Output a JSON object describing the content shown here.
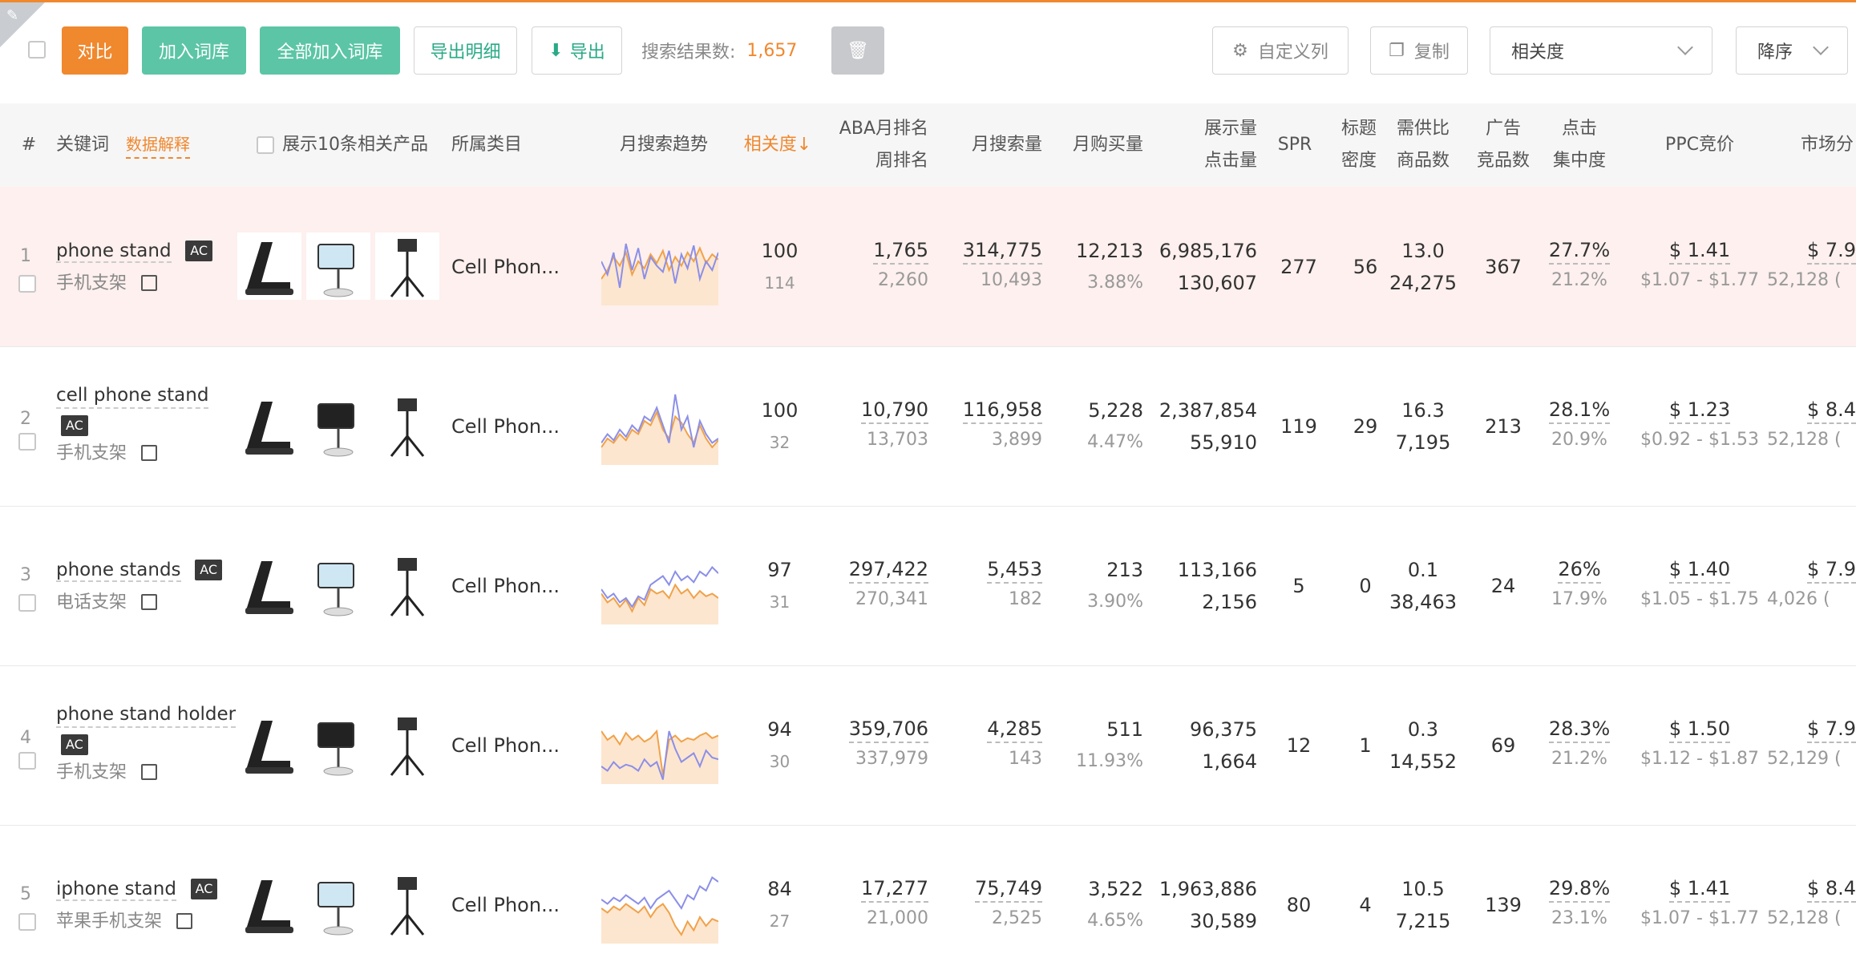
{
  "toolbar": {
    "compare": "对比",
    "add_lib": "加入词库",
    "add_all_lib": "全部加入词库",
    "export_detail": "导出明细",
    "export": "导出",
    "result_label": "搜索结果数:",
    "result_count": "1,657",
    "custom_cols": "自定义列",
    "copy": "复制",
    "sort_by": "相关度",
    "order": "降序"
  },
  "colors": {
    "accent": "#f0882e",
    "green": "#5cc5a5",
    "trend_orange": "#f0a24a",
    "trend_blue": "#8b8fe8"
  },
  "header": {
    "idx": "#",
    "keyword": "关键词",
    "data_explain": "数据解释",
    "show_products": "展示10条相关产品",
    "category": "所属类目",
    "trend": "月搜索趋势",
    "relevance": "相关度↓",
    "aba_month": "ABA月排名",
    "aba_week": "周排名",
    "monthly_search": "月搜索量",
    "monthly_buy": "月购买量",
    "impressions": "展示量",
    "clicks": "点击量",
    "spr": "SPR",
    "title_density_1": "标题",
    "title_density_2": "密度",
    "supply_1": "需供比",
    "supply_2": "商品数",
    "ad_1": "广告",
    "ad_2": "竞品数",
    "click_conc_1": "点击",
    "click_conc_2": "集中度",
    "ppc": "PPC竞价",
    "market": "市场分"
  },
  "rows": [
    {
      "idx": "1",
      "keyword": "phone stand",
      "ac": "AC",
      "cn": "手机支架",
      "category": "Cell Phon...",
      "rel": "100",
      "rel_sub": "114",
      "aba": "1,765",
      "aba_week": "2,260",
      "search": "314,775",
      "search_sub": "10,493",
      "buy": "12,213",
      "buy_rate": "3.88%",
      "impr": "6,985,176",
      "clicks": "130,607",
      "spr": "277",
      "title_density": "56",
      "supply": "13.0",
      "supply_sub": "24,275",
      "ad": "367",
      "conc": "27.7%",
      "conc_sub": "21.2%",
      "ppc": "$ 1.41",
      "ppc_range": "$1.07 - $1.77",
      "market": "$ 7.9",
      "market_sub": "52,128 (",
      "trend": {
        "orange": [
          30,
          40,
          55,
          45,
          60,
          35,
          50,
          42,
          58,
          48,
          62,
          40,
          55,
          45,
          60,
          50,
          65,
          48,
          58,
          52
        ],
        "blue": [
          50,
          35,
          60,
          20,
          70,
          40,
          65,
          30,
          55,
          45,
          38,
          62,
          25,
          58,
          42,
          68,
          30,
          50,
          40,
          60
        ]
      }
    },
    {
      "idx": "2",
      "keyword": "cell phone stand",
      "ac": "AC",
      "cn": "手机支架",
      "category": "Cell Phon...",
      "rel": "100",
      "rel_sub": "32",
      "aba": "10,790",
      "aba_week": "13,703",
      "search": "116,958",
      "search_sub": "3,899",
      "buy": "5,228",
      "buy_rate": "4.47%",
      "impr": "2,387,854",
      "clicks": "55,910",
      "spr": "119",
      "title_density": "29",
      "supply": "16.3",
      "supply_sub": "7,195",
      "ad": "213",
      "conc": "28.1%",
      "conc_sub": "20.9%",
      "ppc": "$ 1.23",
      "ppc_range": "$0.92 - $1.53",
      "market": "$ 8.4",
      "market_sub": "52,128 (",
      "trend": {
        "orange": [
          20,
          30,
          25,
          35,
          28,
          40,
          35,
          50,
          45,
          60,
          40,
          30,
          55,
          48,
          35,
          25,
          45,
          30,
          20,
          28
        ],
        "blue": [
          25,
          35,
          28,
          40,
          32,
          45,
          38,
          55,
          50,
          65,
          45,
          25,
          80,
          40,
          55,
          20,
          50,
          35,
          25,
          30
        ]
      }
    },
    {
      "idx": "3",
      "keyword": "phone stands",
      "ac": "AC",
      "cn": "电话支架",
      "category": "Cell Phon...",
      "rel": "97",
      "rel_sub": "31",
      "aba": "297,422",
      "aba_week": "270,341",
      "search": "5,453",
      "search_sub": "182",
      "buy": "213",
      "buy_rate": "3.90%",
      "impr": "113,166",
      "clicks": "2,156",
      "spr": "5",
      "title_density": "0",
      "supply": "0.1",
      "supply_sub": "38,463",
      "ad": "24",
      "conc": "26%",
      "conc_sub": "17.9%",
      "ppc": "$ 1.40",
      "ppc_range": "$1.05 - $1.75",
      "market": "$ 7.9",
      "market_sub": "4,026 (",
      "trend": {
        "orange": [
          35,
          25,
          30,
          20,
          28,
          15,
          30,
          22,
          40,
          35,
          38,
          30,
          45,
          35,
          40,
          30,
          38,
          32,
          35,
          30
        ],
        "blue": [
          40,
          30,
          35,
          25,
          30,
          20,
          32,
          28,
          45,
          50,
          55,
          45,
          60,
          50,
          55,
          48,
          60,
          55,
          65,
          58
        ]
      }
    },
    {
      "idx": "4",
      "keyword": "phone stand holder",
      "ac": "AC",
      "cn": "手机支架",
      "category": "Cell Phon...",
      "rel": "94",
      "rel_sub": "30",
      "aba": "359,706",
      "aba_week": "337,979",
      "search": "4,285",
      "search_sub": "143",
      "buy": "511",
      "buy_rate": "11.93%",
      "impr": "96,375",
      "clicks": "1,664",
      "spr": "12",
      "title_density": "1",
      "supply": "0.3",
      "supply_sub": "14,552",
      "ad": "69",
      "conc": "28.3%",
      "conc_sub": "21.2%",
      "ppc": "$ 1.50",
      "ppc_range": "$1.12 - $1.87",
      "market": "$ 7.9",
      "market_sub": "52,129 (",
      "trend": {
        "orange": [
          60,
          50,
          55,
          45,
          58,
          50,
          55,
          48,
          52,
          60,
          10,
          50,
          55,
          48,
          52,
          50,
          55,
          58,
          52,
          55
        ],
        "blue": [
          20,
          15,
          25,
          18,
          22,
          20,
          15,
          28,
          20,
          25,
          5,
          60,
          40,
          25,
          30,
          35,
          20,
          38,
          30,
          28
        ]
      }
    },
    {
      "idx": "5",
      "keyword": "iphone stand",
      "ac": "AC",
      "cn": "苹果手机支架",
      "category": "Cell Phon...",
      "rel": "84",
      "rel_sub": "27",
      "aba": "17,277",
      "aba_week": "21,000",
      "search": "75,749",
      "search_sub": "2,525",
      "buy": "3,522",
      "buy_rate": "4.65%",
      "impr": "1,963,886",
      "clicks": "30,589",
      "spr": "80",
      "title_density": "4",
      "supply": "10.5",
      "supply_sub": "7,215",
      "ad": "139",
      "conc": "29.8%",
      "conc_sub": "23.1%",
      "ppc": "$ 1.41",
      "ppc_range": "$1.07 - $1.77",
      "market": "$ 8.4",
      "market_sub": "52,128 (",
      "trend": {
        "orange": [
          40,
          35,
          42,
          38,
          45,
          40,
          35,
          42,
          30,
          40,
          45,
          35,
          20,
          10,
          25,
          15,
          30,
          20,
          28,
          25
        ],
        "blue": [
          50,
          45,
          52,
          48,
          55,
          50,
          45,
          52,
          40,
          50,
          55,
          60,
          50,
          40,
          55,
          50,
          65,
          60,
          75,
          70
        ]
      }
    }
  ]
}
